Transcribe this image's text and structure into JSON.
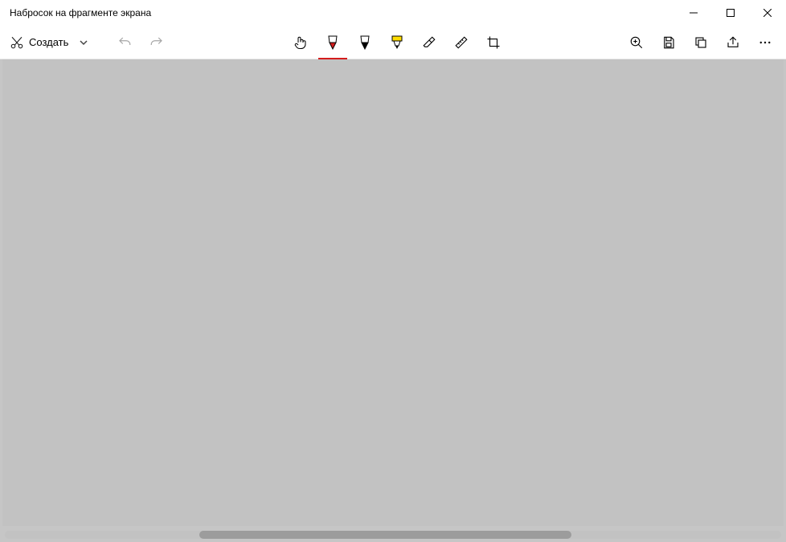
{
  "window": {
    "title": "Набросок на фрагменте экрана"
  },
  "toolbar": {
    "create_label": "Создать",
    "icons": {
      "new": "snip-new-icon",
      "undo": "undo-icon",
      "redo": "redo-icon",
      "touch": "touch-write-icon",
      "pen_red": "ballpoint-pen-icon",
      "pencil_black": "pencil-icon",
      "highlighter": "highlighter-icon",
      "eraser": "eraser-icon",
      "ruler": "ruler-icon",
      "crop": "crop-icon",
      "zoom": "zoom-icon",
      "save": "save-icon",
      "copy": "copy-icon",
      "share": "share-icon",
      "more": "more-icon"
    },
    "selected_tool": "pen_red",
    "pen_colors": {
      "red": "#d41c1c",
      "black": "#000000",
      "yellow": "#ffdd00"
    }
  }
}
